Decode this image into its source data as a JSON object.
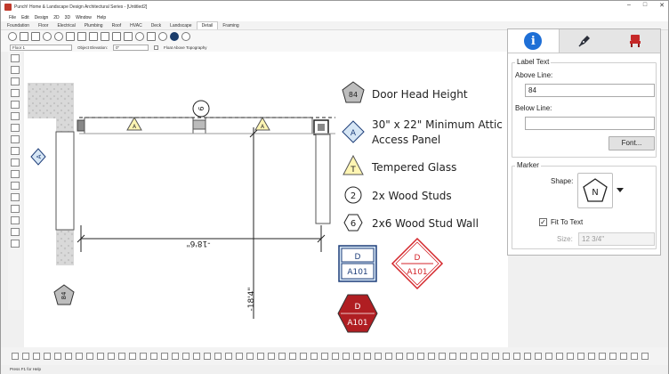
{
  "window": {
    "title": "Punch! Home & Landscape Design Architectural Series - [Untitled2]",
    "controls": [
      "–",
      "□",
      "✕"
    ]
  },
  "menu": [
    "File",
    "Edit",
    "Design",
    "2D",
    "3D",
    "Window",
    "Help"
  ],
  "ribbon_tabs": [
    "Foundation",
    "Floor",
    "Electrical",
    "Plumbing",
    "Roof",
    "HVAC",
    "Deck",
    "Landscape",
    "Detail",
    "Framing"
  ],
  "active_ribbon_tab": "Detail",
  "options_bar": {
    "floor": "Floor 1",
    "object_elevation_label": "Object Elevation:",
    "object_elevation_value": "0\"",
    "float_label": "Float Above Topography"
  },
  "status_bar": "Press F1 for Help",
  "drawing": {
    "door_tag": "84",
    "window_tag_a": "A",
    "window_tag_t": "T",
    "section_tag": "6",
    "dim_horizontal": "-18'6\"",
    "dim_vertical": "-18'4\"",
    "legend": [
      {
        "symbol": "84",
        "shape": "pentagon",
        "text": "Door Head Height"
      },
      {
        "symbol": "A",
        "shape": "diamond",
        "text": "30\" x 22\" Minimum Attic",
        "text2": "Access Panel"
      },
      {
        "symbol": "T",
        "shape": "triangle",
        "text": "Tempered Glass"
      },
      {
        "symbol": "2",
        "shape": "circle",
        "text": "2x Wood Studs"
      },
      {
        "symbol": "6",
        "shape": "hexagon-outline",
        "text": "2x6 Wood Stud Wall"
      }
    ],
    "detail_tags": [
      {
        "top": "D",
        "bottom": "A101",
        "shape": "square",
        "color": "#1f3f7a"
      },
      {
        "top": "D",
        "bottom": "A101",
        "shape": "diamond",
        "color": "#d4262b"
      },
      {
        "top": "D",
        "bottom": "A101",
        "shape": "hexagon",
        "color": "#b01e22"
      }
    ]
  },
  "panel": {
    "tabs": [
      "info-icon",
      "pen-icon",
      "chair-icon"
    ],
    "label_text_group": "Label Text",
    "above_line_label": "Above Line:",
    "above_line_value": "84",
    "below_line_label": "Below Line:",
    "below_line_value": "",
    "font_button": "Font...",
    "marker_group": "Marker",
    "shape_label": "Shape:",
    "shape_letter": "N",
    "fit_to_text_label": "Fit To Text",
    "fit_to_text_checked": true,
    "size_label": "Size:",
    "size_value": "12 3/4\""
  },
  "colors": {
    "accent_blue": "#1e6fd6",
    "tag_yellow": "#fff5b3",
    "tag_blue_fill": "#d6e6f5",
    "wall_gray": "#c8c8c8"
  }
}
